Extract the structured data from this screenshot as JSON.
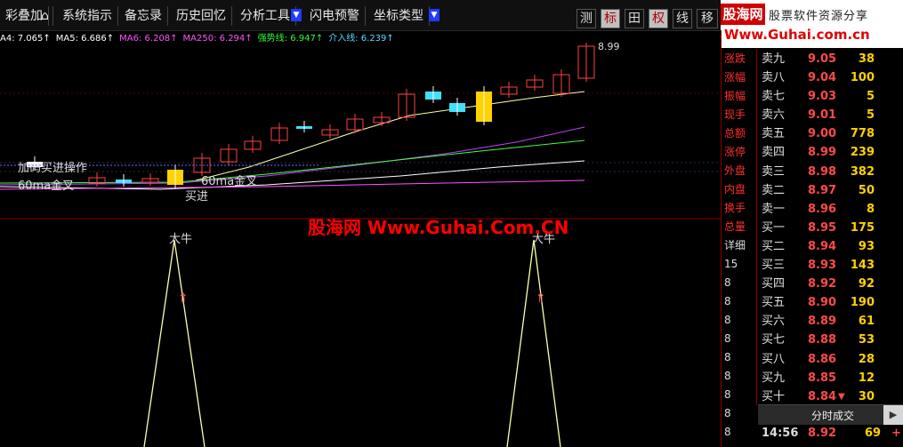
{
  "toolbar": {
    "items": [
      "彩叠加",
      "系统指示",
      "备忘录",
      "历史回忆",
      "分析工具",
      "闪电预警",
      "坐标类型"
    ],
    "icons": [
      {
        "label": "测",
        "active": false
      },
      {
        "label": "标",
        "active": true
      },
      {
        "label": "田",
        "active": false
      },
      {
        "label": "权",
        "active": true
      },
      {
        "label": "线",
        "active": false
      },
      {
        "label": "移",
        "active": false
      }
    ]
  },
  "brand": {
    "cn": "股海网",
    "slogan": "股票软件资源分享",
    "url": "Www.Guhai.com.cn"
  },
  "ma_row": [
    {
      "text": "A4: 7.065↑",
      "color": "#ffffff"
    },
    {
      "text": "MA5: 6.686↑",
      "color": "#ffffff"
    },
    {
      "text": "MA6: 6.208↑",
      "color": "#ff55ff"
    },
    {
      "text": "MA250: 6.294↑",
      "color": "#ff55ff"
    },
    {
      "text": "强势线: 6.947↑",
      "color": "#33ff33"
    },
    {
      "text": "介入线: 6.239↑",
      "color": "#55ddff"
    }
  ],
  "chart": {
    "high_label": "8.99",
    "labels": {
      "add_buy": "加码买进操作",
      "ma_cross": "60ma金叉",
      "buy": "买进",
      "golden": "60ma金叉"
    },
    "watermark": "股海网 Www.Guhai.Com.CN",
    "niu_label": "大牛"
  },
  "side_labels": [
    "涨跌",
    "涨幅",
    "振幅",
    "现手",
    "总额",
    "涨停",
    "外盘",
    "内盘",
    "换手",
    "总量"
  ],
  "side_bottom": [
    "详细",
    "15",
    "8",
    "8",
    "8",
    "8",
    "8",
    "8",
    "8",
    "8",
    "8"
  ],
  "order_book": [
    {
      "label": "卖九",
      "price": "9.05",
      "vol": "38"
    },
    {
      "label": "卖八",
      "price": "9.04",
      "vol": "100"
    },
    {
      "label": "卖七",
      "price": "9.03",
      "vol": "5"
    },
    {
      "label": "卖六",
      "price": "9.01",
      "vol": "5"
    },
    {
      "label": "卖五",
      "price": "9.00",
      "vol": "778"
    },
    {
      "label": "卖四",
      "price": "8.99",
      "vol": "239"
    },
    {
      "label": "卖三",
      "price": "8.98",
      "vol": "382"
    },
    {
      "label": "卖二",
      "price": "8.97",
      "vol": "50"
    },
    {
      "label": "卖一",
      "price": "8.96",
      "vol": "8"
    },
    {
      "label": "买一",
      "price": "8.95",
      "vol": "175"
    },
    {
      "label": "买二",
      "price": "8.94",
      "vol": "93"
    },
    {
      "label": "买三",
      "price": "8.93",
      "vol": "143"
    },
    {
      "label": "买四",
      "price": "8.92",
      "vol": "92"
    },
    {
      "label": "买五",
      "price": "8.90",
      "vol": "190"
    },
    {
      "label": "买六",
      "price": "8.89",
      "vol": "61"
    },
    {
      "label": "买七",
      "price": "8.88",
      "vol": "53"
    },
    {
      "label": "买八",
      "price": "8.86",
      "vol": "28"
    },
    {
      "label": "买九",
      "price": "8.85",
      "vol": "12"
    },
    {
      "label": "买十",
      "price": "8.84",
      "vol": "30",
      "down": true
    }
  ],
  "trades": {
    "title": "分时成交",
    "row": {
      "time": "14:56",
      "price": "8.92",
      "vol": "69",
      "flag": "+"
    }
  },
  "colors": {
    "up_red": "#ff3030",
    "price_line": "#ffffaa",
    "ma_magenta": "#c040ff",
    "ma_green": "#40ff40",
    "panel_border": "#8b0000"
  }
}
